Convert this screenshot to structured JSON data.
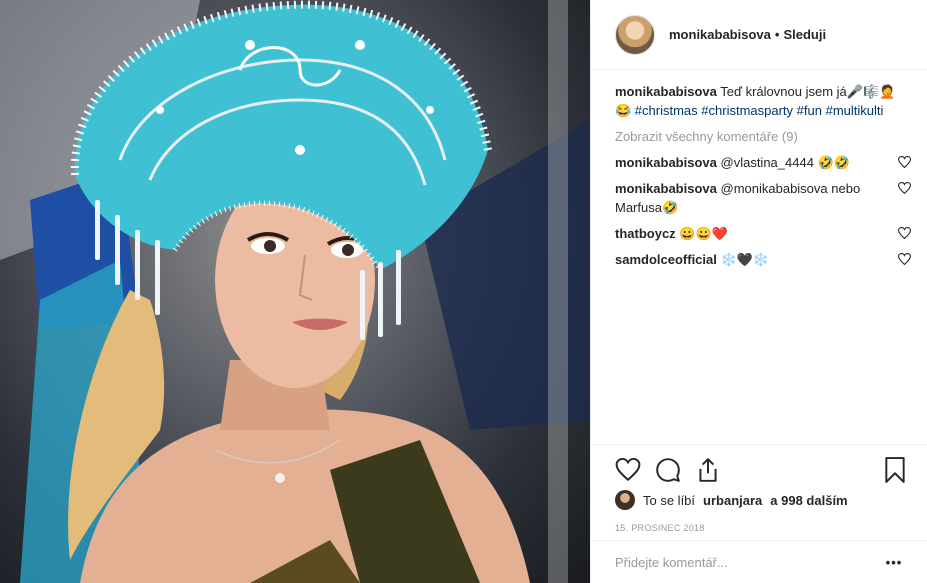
{
  "post": {
    "username": "monikababisova",
    "follow_label": "Sleduji",
    "caption_text": "Teď královnou jsem já",
    "caption_emoji": "🎤🎼🤦",
    "hashtags": [
      "😂 #christmas",
      "#christmasparty",
      "#fun",
      "#multikulti"
    ],
    "view_all": "Zobrazit všechny komentáře (9)",
    "comments": [
      {
        "user": "monikababisova",
        "text": "@vlastina_4444 🤣🤣"
      },
      {
        "user": "monikababisova",
        "text": "@monikababisova nebo Marfusa🤣"
      },
      {
        "user": "thatboycz",
        "text": "😀😀❤️"
      },
      {
        "user": "samdolceofficial",
        "text": "❄️🖤❄️"
      }
    ],
    "likes_prefix": "To se líbí",
    "likes_user": "urbanjara",
    "likes_suffix": "a 998 dalším",
    "date": "15. PROSINEC 2018",
    "comment_placeholder": "Přidejte komentář...",
    "more_label": "•••"
  },
  "colors": {
    "accent_crown": "#3fc0d3",
    "link": "#003569",
    "muted": "#999999"
  }
}
